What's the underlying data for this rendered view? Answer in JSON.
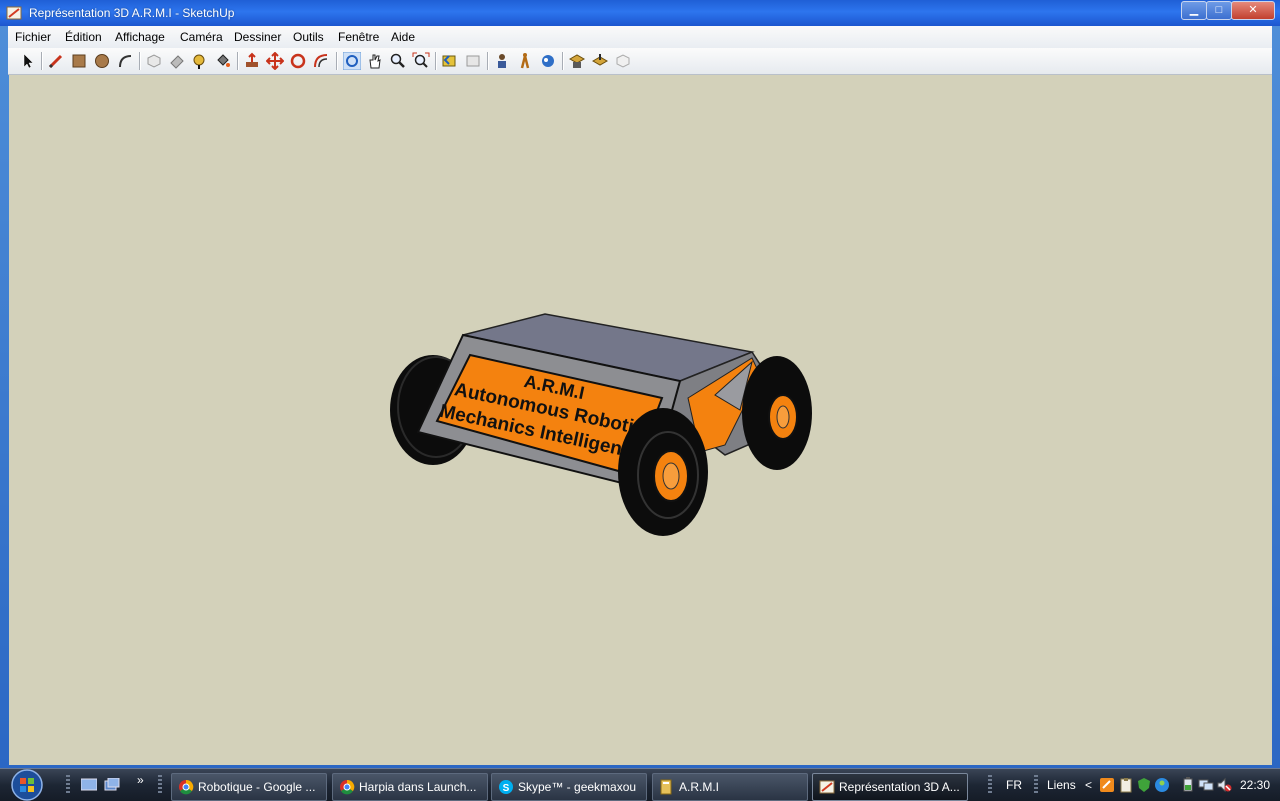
{
  "window": {
    "title": "Représentation 3D A.R.M.I - SketchUp"
  },
  "window_controls": {
    "minimize": "▁",
    "maximize": "□",
    "close": "✕"
  },
  "menu": [
    "Fichier",
    "Édition",
    "Affichage",
    "Caméra",
    "Dessiner",
    "Outils",
    "Fenêtre",
    "Aide"
  ],
  "toolbar": {
    "tools": [
      "select-icon",
      "pencil-icon",
      "rectangle-icon",
      "circle-icon",
      "arc-icon",
      "make-component-icon",
      "eraser-icon",
      "tape-measure-icon",
      "paint-bucket-icon",
      "push-pull-icon",
      "move-icon",
      "rotate-icon",
      "offset-icon",
      "orbit-icon",
      "pan-icon",
      "zoom-icon",
      "zoom-extents-icon",
      "previous-view-icon",
      "next-view-icon",
      "position-camera-icon",
      "walk-icon",
      "look-around-icon",
      "get-models-icon",
      "share-model-icon",
      "component-icon"
    ]
  },
  "model": {
    "label_lines": [
      "A.R.M.I",
      "Autonomous Robotic",
      "Mechanics Intelligence"
    ],
    "colors": {
      "orange": "#f4820f",
      "gray": "#8d8e92",
      "top": "#74778a",
      "tire": "#0c0c0c",
      "background": "#d3d1ba"
    }
  },
  "taskbar": {
    "quick_launch_more": "»",
    "tasks": [
      {
        "label": "Robotique - Google ...",
        "icon": "chrome-icon"
      },
      {
        "label": "Harpia dans Launch...",
        "icon": "chrome-icon"
      },
      {
        "label": "Skype™ - geekmaxou",
        "icon": "skype-icon"
      },
      {
        "label": "A.R.M.I",
        "icon": "folder-icon"
      },
      {
        "label": "Représentation 3D A...",
        "icon": "sketchup-icon",
        "active": true
      }
    ],
    "tray": {
      "language": "FR",
      "links": "Liens",
      "chevron": "<",
      "clock": "22:30"
    }
  }
}
